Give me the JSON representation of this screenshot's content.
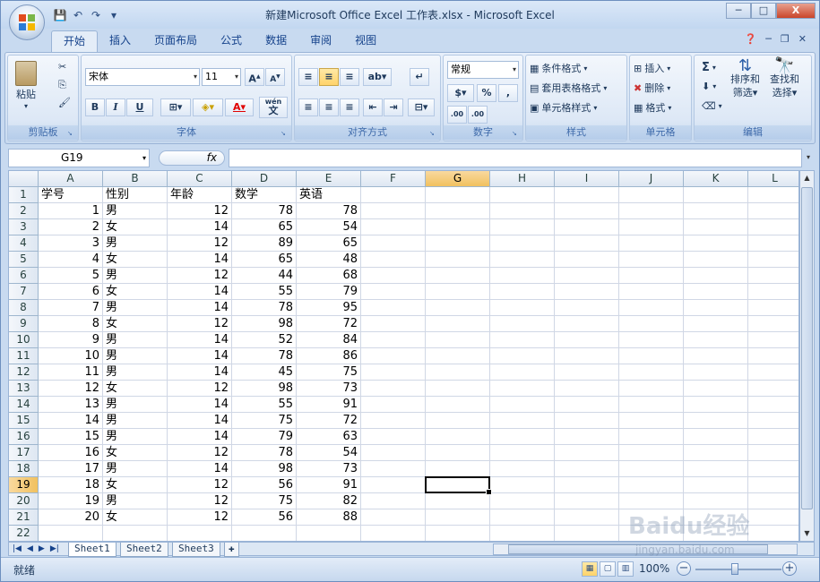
{
  "window": {
    "title": "新建Microsoft Office Excel 工作表.xlsx - Microsoft Excel",
    "controls": {
      "minimize": "─",
      "maximize": "□",
      "close": "X"
    }
  },
  "ribbon_tabs": [
    "开始",
    "插入",
    "页面布局",
    "公式",
    "数据",
    "审阅",
    "视图"
  ],
  "ribbon": {
    "clipboard": {
      "label": "剪贴板",
      "paste": "粘贴"
    },
    "font": {
      "label": "字体",
      "font_name": "宋体",
      "font_size": "11",
      "bold": "B",
      "italic": "I",
      "underline": "U",
      "font_color_letter": "A",
      "wen": "wén",
      "wen_char": "文"
    },
    "alignment": {
      "label": "对齐方式"
    },
    "number": {
      "label": "数字",
      "format": "常规",
      "percent": "%",
      "comma": ",",
      "dec_inc": ".00",
      "dec_dec": ".00"
    },
    "styles": {
      "label": "样式",
      "conditional": "条件格式",
      "table_format": "套用表格格式",
      "cell_styles": "单元格样式"
    },
    "cells": {
      "label": "单元格",
      "insert": "插入",
      "delete": "删除",
      "format": "格式"
    },
    "editing": {
      "label": "编辑",
      "sort": "排序和",
      "sort2": "筛选",
      "find": "查找和",
      "find2": "选择",
      "sigma": "Σ"
    }
  },
  "formula_bar": {
    "name_box": "G19",
    "fx": "fx",
    "value": ""
  },
  "columns": [
    "A",
    "B",
    "C",
    "D",
    "E",
    "F",
    "G",
    "H",
    "I",
    "J",
    "K",
    "L"
  ],
  "selected_column": "G",
  "selected_row": "19",
  "rows": [
    [
      "学号",
      "性别",
      "年龄",
      "数学",
      "英语"
    ],
    [
      "1",
      "男",
      "12",
      "78",
      "78"
    ],
    [
      "2",
      "女",
      "14",
      "65",
      "54"
    ],
    [
      "3",
      "男",
      "12",
      "89",
      "65"
    ],
    [
      "4",
      "女",
      "14",
      "65",
      "48"
    ],
    [
      "5",
      "男",
      "12",
      "44",
      "68"
    ],
    [
      "6",
      "女",
      "14",
      "55",
      "79"
    ],
    [
      "7",
      "男",
      "14",
      "78",
      "95"
    ],
    [
      "8",
      "女",
      "12",
      "98",
      "72"
    ],
    [
      "9",
      "男",
      "14",
      "52",
      "84"
    ],
    [
      "10",
      "男",
      "14",
      "78",
      "86"
    ],
    [
      "11",
      "男",
      "14",
      "45",
      "75"
    ],
    [
      "12",
      "女",
      "12",
      "98",
      "73"
    ],
    [
      "13",
      "男",
      "14",
      "55",
      "91"
    ],
    [
      "14",
      "男",
      "14",
      "75",
      "72"
    ],
    [
      "15",
      "男",
      "14",
      "79",
      "63"
    ],
    [
      "16",
      "女",
      "12",
      "78",
      "54"
    ],
    [
      "17",
      "男",
      "14",
      "98",
      "73"
    ],
    [
      "18",
      "女",
      "12",
      "56",
      "91"
    ],
    [
      "19",
      "男",
      "12",
      "75",
      "82"
    ],
    [
      "20",
      "女",
      "12",
      "56",
      "88"
    ],
    [
      "",
      "",
      "",
      "",
      ""
    ]
  ],
  "sheet_tabs": [
    "Sheet1",
    "Sheet2",
    "Sheet3"
  ],
  "active_sheet": "Sheet1",
  "status": {
    "ready": "就绪",
    "zoom": "100%"
  },
  "watermark": {
    "main": "Baidu经验",
    "sub": "jingyan.baidu.com"
  }
}
